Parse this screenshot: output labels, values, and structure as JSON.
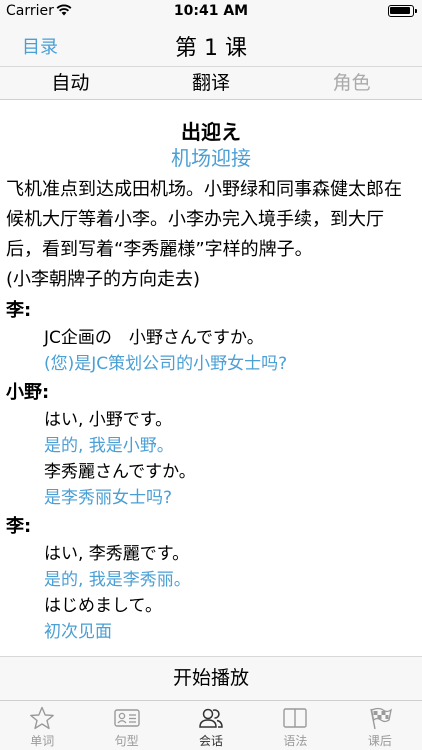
{
  "status": {
    "carrier": "Carrier",
    "time": "10:41 AM"
  },
  "nav": {
    "back_label": "目录",
    "title": "第 1 课"
  },
  "segments": [
    "自动",
    "翻译",
    "角色"
  ],
  "lesson": {
    "title": "出迎え",
    "subtitle": "机场迎接",
    "intro": "飞机准点到达成田机场。小野绿和同事森健太郎在候机大厅等着小李。小李办完入境手续，到大厅后，看到写着“李秀麗様”字样的牌子。",
    "direction": "(小李朝牌子的方向走去)"
  },
  "dialogue": [
    {
      "speaker": "李:",
      "lines": [
        {
          "ja": "JC企画の　小野さんですか。",
          "zh": "(您)是JC策划公司的小野女士吗?"
        }
      ]
    },
    {
      "speaker": "小野:",
      "lines": [
        {
          "ja": "はい, 小野です。",
          "zh": "是的, 我是小野。"
        },
        {
          "ja": "李秀麗さんですか。",
          "zh": "是李秀丽女士吗?"
        }
      ]
    },
    {
      "speaker": "李:",
      "lines": [
        {
          "ja": "はい, 李秀麗です。",
          "zh": "是的, 我是李秀丽。"
        },
        {
          "ja": "はじめまして。",
          "zh": "初次见面"
        }
      ]
    }
  ],
  "play_label": "开始播放",
  "tabs": [
    {
      "label": "单词",
      "icon": "star-icon"
    },
    {
      "label": "句型",
      "icon": "id-card-icon"
    },
    {
      "label": "会话",
      "icon": "people-icon"
    },
    {
      "label": "语法",
      "icon": "book-icon"
    },
    {
      "label": "课后",
      "icon": "checkered-flag-icon"
    }
  ],
  "colors": {
    "accent": "#4a9fd5",
    "inactive": "#9a9a9a",
    "bar_bg": "#f7f7f7"
  }
}
